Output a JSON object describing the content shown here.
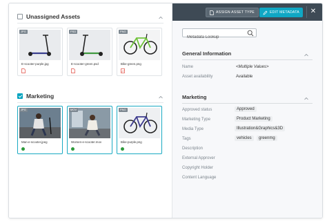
{
  "groups": [
    {
      "title": "Unassigned Assets",
      "checked": false,
      "assets": [
        {
          "badge": "JPG",
          "filename": "E-scooter-purple.jpg",
          "image": "scooter-purple",
          "selected": false,
          "status": "file-icon"
        },
        {
          "badge": "PSD",
          "filename": "E-scooter-green.psd",
          "image": "scooter-green",
          "selected": false,
          "status": "file-icon"
        },
        {
          "badge": "PNG",
          "filename": "Bike-green.png",
          "image": "bike-green",
          "selected": false,
          "status": "file-icon"
        }
      ]
    },
    {
      "title": "Marketing",
      "checked": true,
      "assets": [
        {
          "badge": "JPG",
          "filename": "Man-e-scooter.jpeg",
          "image": "man-scooter-photo",
          "selected": true,
          "status": "green-dot"
        },
        {
          "badge": "MOV",
          "filename": "Women-e-scooter.mov",
          "image": "woman-scooter-photo",
          "selected": true,
          "status": "green-dot"
        },
        {
          "badge": "PNG",
          "filename": "Bike-purple.png",
          "image": "bike-purple",
          "selected": true,
          "status": "green-dot"
        }
      ]
    }
  ],
  "toolbar": {
    "assign_label": "ASSIGN ASSET TYPE",
    "edit_label": "EDIT METADATA",
    "close_icon": "close-icon"
  },
  "search": {
    "placeholder": "Metadata Lookup"
  },
  "general": {
    "title": "General Information",
    "fields": [
      {
        "label": "Name",
        "value": "<Multiple Values>"
      },
      {
        "label": "Asset availability",
        "value": "Available"
      }
    ]
  },
  "marketing": {
    "title": "Marketing",
    "fields": [
      {
        "label": "Approved status",
        "chips": [
          "Approved"
        ]
      },
      {
        "label": "Marketing Type",
        "chips": [
          "Product Marketing"
        ]
      },
      {
        "label": "Media Type",
        "chips": [
          "Illustration&Graphics&3D"
        ]
      },
      {
        "label": "Tags",
        "chips": [
          "vehicles",
          "greenmg"
        ]
      },
      {
        "label": "Description",
        "chips": []
      },
      {
        "label": "External Approver",
        "chips": []
      },
      {
        "label": "Copyright Holder",
        "chips": []
      },
      {
        "label": "Content Language",
        "chips": []
      }
    ]
  },
  "colors": {
    "accent": "#10a7c4",
    "toolbar": "#3e4a55",
    "status_green": "#2e9a3c",
    "file_red": "#e0483e"
  }
}
